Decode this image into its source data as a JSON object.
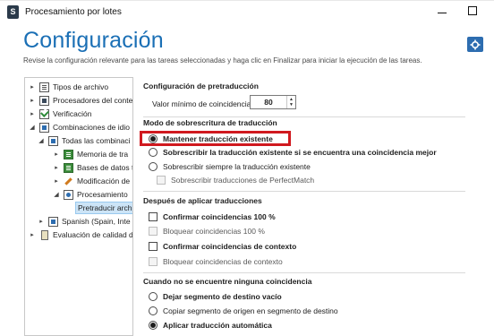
{
  "window": {
    "title": "Procesamiento por lotes",
    "app_icon": "S"
  },
  "page": {
    "title": "Configuración",
    "description": "Revise la configuración relevante para las tareas seleccionadas y haga clic en Finalizar para iniciar la ejecución de las tareas."
  },
  "tree": {
    "items": [
      {
        "label": "Tipos de archivo",
        "icon": "file-types-icon"
      },
      {
        "label": "Procesadores del conte",
        "icon": "processor-icon"
      },
      {
        "label": "Verificación",
        "icon": "verification-icon"
      },
      {
        "label": "Combinaciones de idio",
        "icon": "language-pairs-icon"
      },
      {
        "label": "Todas las combinaci",
        "icon": "all-pairs-icon"
      },
      {
        "label": "Memoria de tra",
        "icon": "translation-memory-icon"
      },
      {
        "label": "Bases de datos t",
        "icon": "termbase-icon"
      },
      {
        "label": "Modificación de",
        "icon": "wrench-icon"
      },
      {
        "label": "Procesamiento",
        "icon": "gear-icon"
      },
      {
        "label": "Pretraducir arch",
        "icon": "none"
      },
      {
        "label": "Spanish (Spain, Inte",
        "icon": "language-icon"
      },
      {
        "label": "Evaluación de calidad d",
        "icon": "qa-icon"
      }
    ]
  },
  "pretranslation": {
    "heading": "Configuración de pretraducción",
    "min_match_label": "Valor mínimo de coincidencia:",
    "min_match_value": "80"
  },
  "overwrite": {
    "heading": "Modo de sobrescritura de traducción",
    "options": [
      "Mantener traducción existente",
      "Sobrescribir la traducción existente si se encuentra una coincidencia mejor",
      "Sobrescribir siempre la traducción existente"
    ],
    "sub_option": "Sobrescribir traducciones de PerfectMatch"
  },
  "after_apply": {
    "heading": "Después de aplicar traducciones",
    "options": [
      "Confirmar coincidencias 100 %",
      "Bloquear coincidencias 100 %",
      "Confirmar coincidencias de contexto",
      "Bloquear coincidencias de contexto"
    ]
  },
  "no_match": {
    "heading": "Cuando no se encuentre ninguna coincidencia",
    "options": [
      "Dejar segmento de destino vacío",
      "Copiar segmento de origen en segmento de destino",
      "Aplicar traducción automática"
    ]
  },
  "colors": {
    "title_blue": "#1a6fb5",
    "highlight_red": "#d0191f",
    "selection": "#cce4f7"
  }
}
